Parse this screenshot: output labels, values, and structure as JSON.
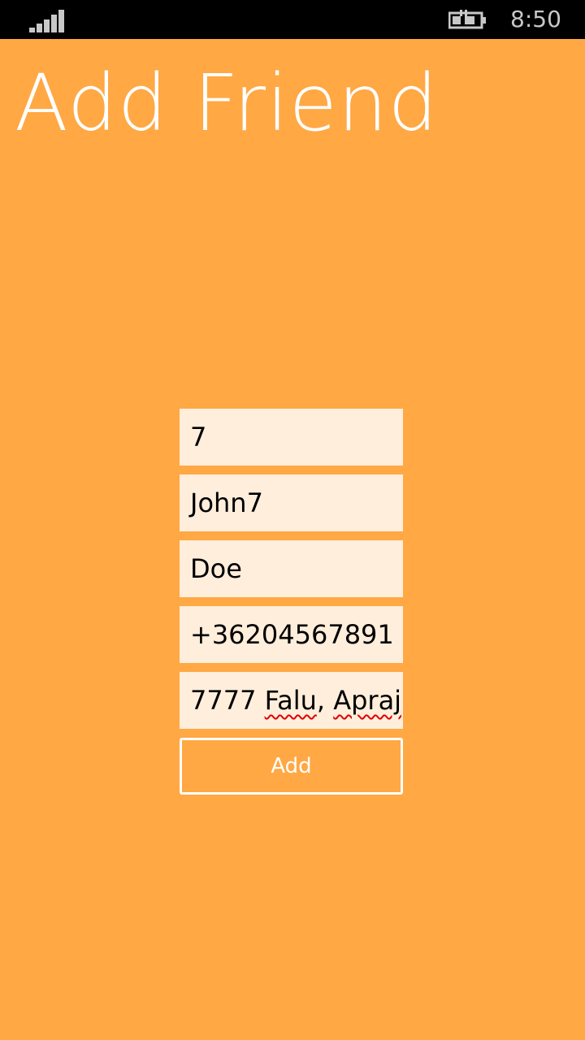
{
  "status_bar": {
    "time": "8:50",
    "signal_icon": "signal-strength-icon",
    "battery_icon": "battery-charging-icon"
  },
  "page": {
    "title": "Add Friend"
  },
  "form": {
    "id_value": "7",
    "first_name_value": "John7",
    "last_name_value": "Doe",
    "phone_value": "+36204567891",
    "address_part1": "7777 ",
    "address_word1": "Falu",
    "address_part2": ", ",
    "address_word2": "Apraj",
    "add_label": "Add"
  },
  "colors": {
    "background": "#FFA844",
    "field_background": "#FFEEDC",
    "text_light": "#FFFFFF",
    "spellcheck": "#E00000"
  }
}
